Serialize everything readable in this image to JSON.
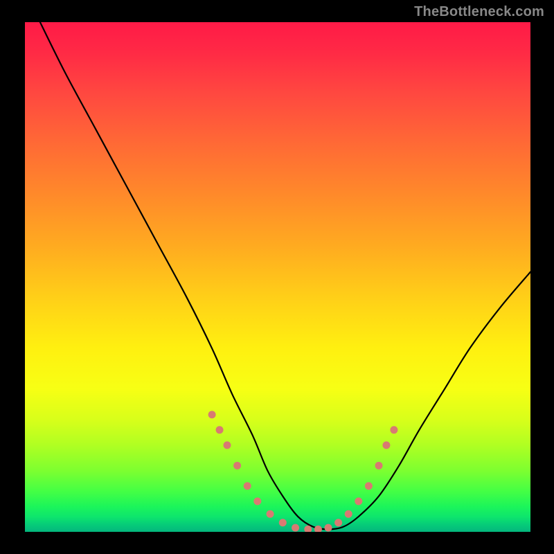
{
  "watermark": "TheBottleneck.com",
  "chart_data": {
    "type": "line",
    "title": "",
    "xlabel": "",
    "ylabel": "",
    "xlim": [
      0,
      100
    ],
    "ylim": [
      0,
      100
    ],
    "series": [
      {
        "name": "curve",
        "x": [
          3,
          8,
          14,
          20,
          26,
          32,
          37,
          41,
          45,
          48,
          51,
          54,
          57,
          60,
          63,
          66,
          70,
          74,
          78,
          83,
          88,
          94,
          100
        ],
        "y": [
          100,
          90,
          79,
          68,
          57,
          46,
          36,
          27,
          19,
          12,
          7,
          3,
          1,
          0.5,
          1,
          3,
          7,
          13,
          20,
          28,
          36,
          44,
          51
        ]
      }
    ],
    "highlight_points": {
      "name": "dots",
      "color": "#d87a72",
      "x": [
        37,
        38.5,
        40,
        42,
        44,
        46,
        48.5,
        51,
        53.5,
        56,
        58,
        60,
        62,
        64,
        66,
        68,
        70,
        71.5,
        73
      ],
      "y": [
        23,
        20,
        17,
        13,
        9,
        6,
        3.5,
        1.8,
        0.8,
        0.5,
        0.5,
        0.8,
        1.8,
        3.5,
        6,
        9,
        13,
        17,
        20
      ]
    },
    "background_gradient": {
      "top_color": "#ff1a47",
      "bottom_color": "#04b67d"
    }
  }
}
